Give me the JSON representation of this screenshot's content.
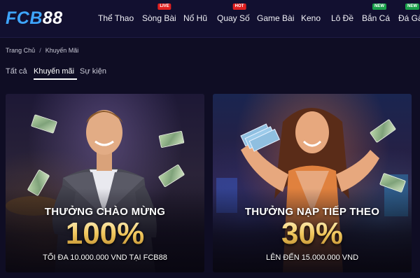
{
  "brand": {
    "logo_main": "FCB",
    "logo_num": "88"
  },
  "nav": {
    "items": [
      {
        "label": "Thể Thao",
        "badge": ""
      },
      {
        "label": "Sòng Bài",
        "badge": "LIVE"
      },
      {
        "label": "Nổ Hũ",
        "badge": ""
      },
      {
        "label": "Quay Số",
        "badge": "HOT"
      },
      {
        "label": "Game Bài",
        "badge": ""
      },
      {
        "label": "Keno",
        "badge": ""
      },
      {
        "label": "Lô Đề",
        "badge": ""
      },
      {
        "label": "Bắn Cá",
        "badge": "NEW"
      },
      {
        "label": "Đá Gà",
        "badge": "NEW"
      }
    ]
  },
  "breadcrumb": {
    "home": "Trang Chủ",
    "separator": "/",
    "current": "Khuyến Mãi"
  },
  "tabs": [
    {
      "label": "Tất cả",
      "active": false
    },
    {
      "label": "Khuyến mãi",
      "active": true
    },
    {
      "label": "Sự kiện",
      "active": false
    }
  ],
  "promos": [
    {
      "title": "THƯỞNG CHÀO MỪNG",
      "percent": "100%",
      "subtitle": "TỐI ĐA 10.000.000 VND TẠI FCB88"
    },
    {
      "title": "THƯỞNG NẠP TIẾP THEO",
      "percent": "30%",
      "subtitle": "LÊN ĐẾN 15.000.000 VND"
    }
  ],
  "colors": {
    "background": "#0f0d24",
    "header": "#121030",
    "accent_blue": "#3ea5ff",
    "gold": "#f0c65c",
    "badge_red": "#e02020",
    "badge_green": "#1aa04a"
  }
}
